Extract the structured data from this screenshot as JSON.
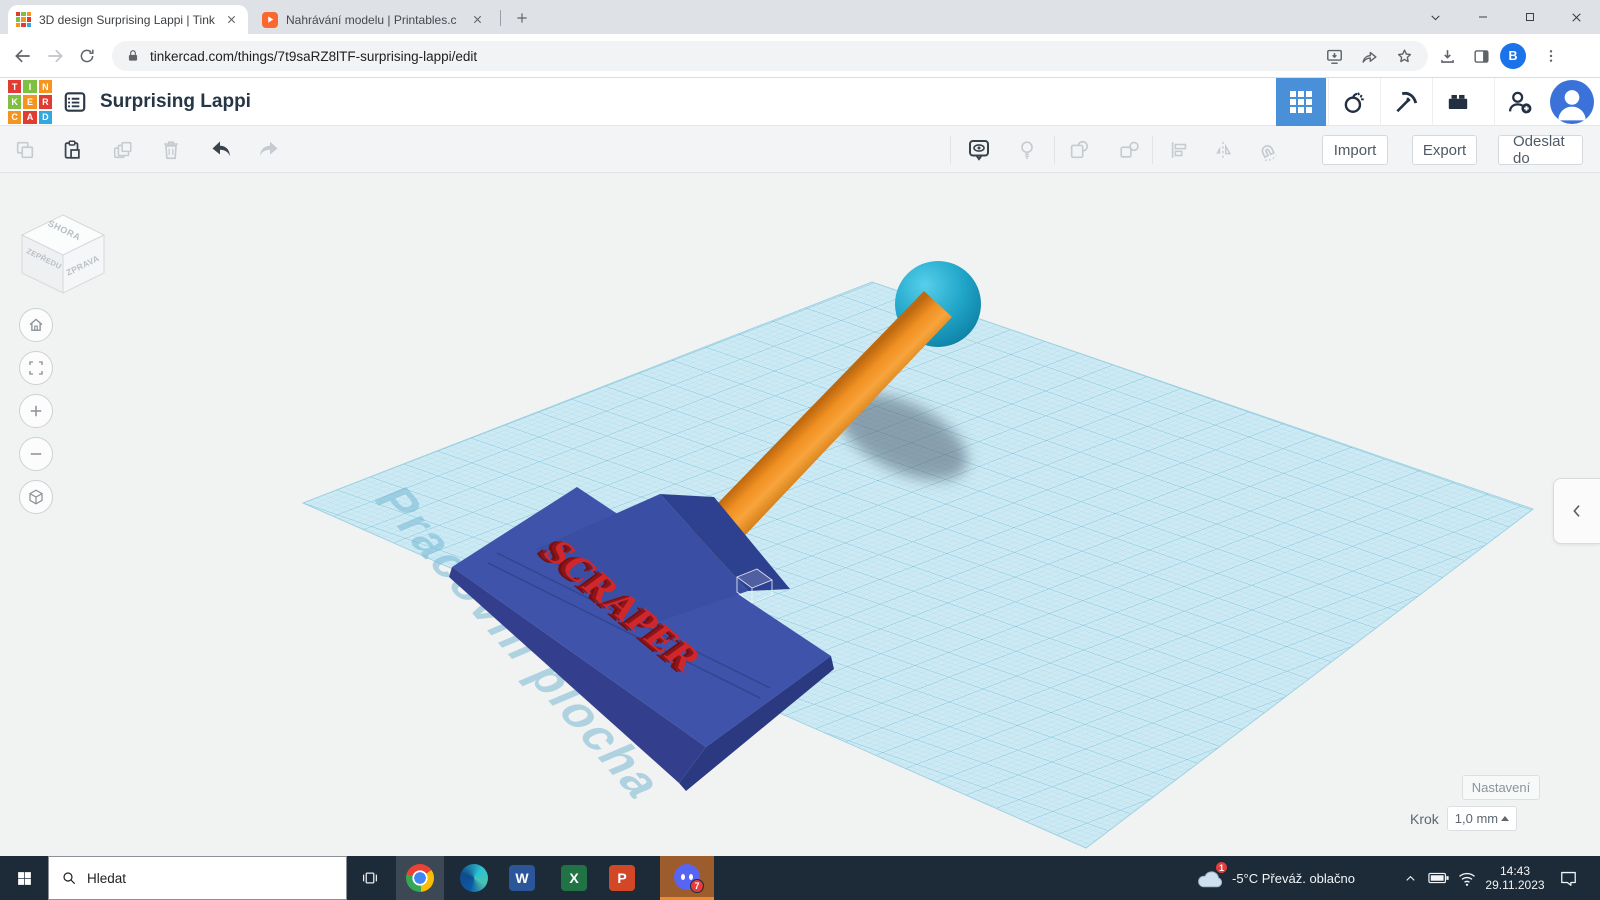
{
  "browser": {
    "tabs": [
      {
        "title": "3D design Surprising Lappi | Tink"
      },
      {
        "title": "Nahrávání modelu | Printables.c"
      }
    ],
    "url": "tinkercad.com/things/7t9saRZ8lTF-surprising-lappi/edit",
    "profile_initial": "B"
  },
  "header": {
    "title": "Surprising Lappi",
    "logo_tiles": [
      {
        "ch": "T"
      },
      {
        "ch": "I"
      },
      {
        "ch": "N"
      },
      {
        "ch": "K"
      },
      {
        "ch": "E"
      },
      {
        "ch": "R"
      },
      {
        "ch": "C"
      },
      {
        "ch": "A"
      },
      {
        "ch": "D"
      }
    ]
  },
  "toolbar": {
    "import_label": "Import",
    "export_label": "Export",
    "send_label": "Odeslat do"
  },
  "viewcube": {
    "top": "SHORA",
    "front": "ZEPŘEDU",
    "right": "ZPRAVA"
  },
  "scene": {
    "workplane_label": "Pracovní plocha",
    "model_text": "SCRAPER"
  },
  "colors": {
    "accent_blue": "#4a90d9",
    "workplane": "#cdeaf4",
    "model_head": "#3e53a9",
    "model_handle": "#ef8c1f",
    "model_ball": "#21a6c9",
    "model_text_red": "#d0272c",
    "taskbar_bg": "#1d2a37"
  },
  "settings": {
    "settings_label": "Nastavení",
    "step_label": "Krok",
    "step_value": "1,0 mm"
  },
  "taskbar": {
    "search_label": "Hledat",
    "weather_text": "-5°C Převáž. oblačno",
    "weather_badge": "1",
    "app_badge": "7",
    "time": "14:43",
    "date": "29.11.2023"
  }
}
